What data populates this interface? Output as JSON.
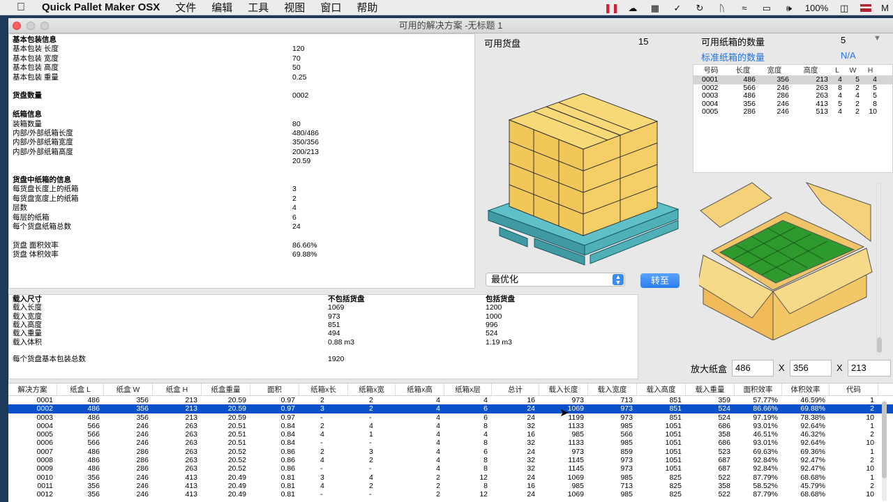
{
  "menubar": {
    "app_name": "Quick Pallet Maker OSX",
    "menus": [
      "文件",
      "编辑",
      "工具",
      "视图",
      "窗口",
      "帮助"
    ],
    "battery": "100%",
    "clock": "M"
  },
  "window": {
    "title": "可用的解决方案 -无标题 1"
  },
  "info": {
    "rows": [
      {
        "label": "基本包装信息",
        "value": "",
        "bold": true
      },
      {
        "label": "基本包装 长度",
        "value": "120"
      },
      {
        "label": "基本包装 宽度",
        "value": "70"
      },
      {
        "label": "基本包装 高度",
        "value": "50"
      },
      {
        "label": "基本包装 重量",
        "value": "0.25"
      },
      {
        "label": "",
        "value": ""
      },
      {
        "label": "货盘数量",
        "value": "0002",
        "bold": true
      },
      {
        "label": "",
        "value": ""
      },
      {
        "label": "纸箱信息",
        "value": "",
        "bold": true
      },
      {
        "label": "装箱数量",
        "value": "80"
      },
      {
        "label": "内部/外部纸箱长度",
        "value": "480/486"
      },
      {
        "label": "内部/外部纸箱宽度",
        "value": "350/356"
      },
      {
        "label": "内部/外部纸箱高度",
        "value": "200/213"
      },
      {
        "label": "",
        "value": "20.59"
      },
      {
        "label": "",
        "value": ""
      },
      {
        "label": "货盘中纸箱的信息",
        "value": "",
        "bold": true
      },
      {
        "label": "每货盘长度上的纸箱",
        "value": "3"
      },
      {
        "label": "每货盘宽度上的纸箱",
        "value": "2"
      },
      {
        "label": "层数",
        "value": "4"
      },
      {
        "label": "每层的纸箱",
        "value": "6"
      },
      {
        "label": "每个货盘纸箱总数",
        "value": "24"
      },
      {
        "label": "",
        "value": ""
      },
      {
        "label": "货盘 面积效率",
        "value": "86.66%"
      },
      {
        "label": "货盘 体积效率",
        "value": "69.88%"
      }
    ]
  },
  "load": {
    "header": {
      "label": "载入尺寸",
      "without": "不包括货盘",
      "with": "包括货盘"
    },
    "rows": [
      {
        "label": "载入长度",
        "without": "1069",
        "with": "1200"
      },
      {
        "label": "载入宽度",
        "without": "973",
        "with": "1000"
      },
      {
        "label": "载入高度",
        "without": "851",
        "with": "996"
      },
      {
        "label": "载入重量",
        "without": "494",
        "with": "524"
      },
      {
        "label": "载入体积",
        "without": "0.88 m3",
        "with": "1.19 m3"
      }
    ],
    "total_label": "每个货盘基本包装总数",
    "total_value": "1920"
  },
  "pallets": {
    "label": "可用货盘",
    "count": "15"
  },
  "cartons": {
    "available_label": "可用纸箱的数量",
    "available_value": "5",
    "standard_label": "标准纸箱的数量",
    "standard_value": "N/A",
    "columns": [
      "号码",
      "长度",
      "宽度",
      "高度",
      "L",
      "W",
      "H"
    ],
    "rows": [
      [
        "0001",
        "486",
        "356",
        "213",
        "4",
        "5",
        "4"
      ],
      [
        "0002",
        "566",
        "246",
        "263",
        "8",
        "2",
        "5"
      ],
      [
        "0003",
        "486",
        "286",
        "263",
        "4",
        "4",
        "5"
      ],
      [
        "0004",
        "356",
        "246",
        "413",
        "5",
        "2",
        "8"
      ],
      [
        "0005",
        "286",
        "246",
        "513",
        "4",
        "2",
        "10"
      ]
    ]
  },
  "controls": {
    "optimize_select": "最优化",
    "goto_button": "转至",
    "zoom_label": "放大纸盒",
    "zoom_l": "486",
    "zoom_w": "356",
    "zoom_h": "213",
    "x1": "X",
    "x2": "X"
  },
  "solutions": {
    "columns": [
      "解决方案",
      "纸盒 L",
      "纸盒 W",
      "纸盒 H",
      "纸盒重量",
      "面积",
      "纸箱x长",
      "纸箱x宽",
      "纸箱x高",
      "纸箱x层",
      "总计",
      "载入长度",
      "载入宽度",
      "载入高度",
      "载入重量",
      "面积效率",
      "体积效率",
      "代码"
    ],
    "selected_index": 1,
    "rows": [
      [
        "0001",
        "486",
        "356",
        "213",
        "20.59",
        "0.97",
        "2",
        "2",
        "4",
        "4",
        "16",
        "973",
        "713",
        "851",
        "359",
        "57.77%",
        "46.59%",
        "1"
      ],
      [
        "0002",
        "486",
        "356",
        "213",
        "20.59",
        "0.97",
        "3",
        "2",
        "4",
        "6",
        "24",
        "1069",
        "973",
        "851",
        "524",
        "86.66%",
        "69.88%",
        "2"
      ],
      [
        "0003",
        "486",
        "356",
        "213",
        "20.59",
        "0.97",
        "-",
        "-",
        "4",
        "6",
        "24",
        "1199",
        "973",
        "851",
        "524",
        "97.19%",
        "78.38%",
        "10"
      ],
      [
        "0004",
        "566",
        "246",
        "263",
        "20.51",
        "0.84",
        "2",
        "4",
        "4",
        "8",
        "32",
        "1133",
        "985",
        "1051",
        "686",
        "93.01%",
        "92.64%",
        "1"
      ],
      [
        "0005",
        "566",
        "246",
        "263",
        "20.51",
        "0.84",
        "4",
        "1",
        "4",
        "4",
        "16",
        "985",
        "566",
        "1051",
        "358",
        "46.51%",
        "46.32%",
        "2"
      ],
      [
        "0006",
        "566",
        "246",
        "263",
        "20.51",
        "0.84",
        "-",
        "-",
        "4",
        "8",
        "32",
        "1133",
        "985",
        "1051",
        "686",
        "93.01%",
        "92.64%",
        "10"
      ],
      [
        "0007",
        "486",
        "286",
        "263",
        "20.52",
        "0.86",
        "2",
        "3",
        "4",
        "6",
        "24",
        "973",
        "859",
        "1051",
        "523",
        "69.63%",
        "69.36%",
        "1"
      ],
      [
        "0008",
        "486",
        "286",
        "263",
        "20.52",
        "0.86",
        "4",
        "2",
        "4",
        "8",
        "32",
        "1145",
        "973",
        "1051",
        "687",
        "92.84%",
        "92.47%",
        "2"
      ],
      [
        "0009",
        "486",
        "286",
        "263",
        "20.52",
        "0.86",
        "-",
        "-",
        "4",
        "8",
        "32",
        "1145",
        "973",
        "1051",
        "687",
        "92.84%",
        "92.47%",
        "10"
      ],
      [
        "0010",
        "356",
        "246",
        "413",
        "20.49",
        "0.81",
        "3",
        "4",
        "2",
        "12",
        "24",
        "1069",
        "985",
        "825",
        "522",
        "87.79%",
        "68.68%",
        "1"
      ],
      [
        "0011",
        "356",
        "246",
        "413",
        "20.49",
        "0.81",
        "4",
        "2",
        "2",
        "8",
        "16",
        "985",
        "713",
        "825",
        "358",
        "58.52%",
        "45.79%",
        "2"
      ],
      [
        "0012",
        "356",
        "246",
        "413",
        "20.49",
        "0.81",
        "-",
        "-",
        "2",
        "12",
        "24",
        "1069",
        "985",
        "825",
        "522",
        "87.79%",
        "68.68%",
        "10"
      ]
    ]
  }
}
